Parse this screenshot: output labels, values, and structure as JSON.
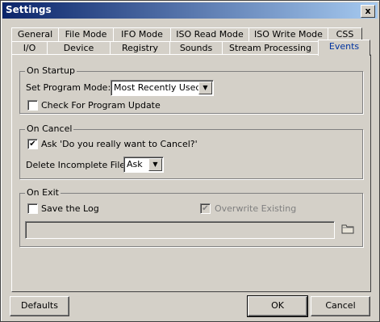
{
  "window": {
    "title": "Settings",
    "close_label": "x"
  },
  "tabs_row1": [
    "General",
    "File Mode",
    "IFO Mode",
    "ISO Read Mode",
    "ISO Write Mode",
    "CSS"
  ],
  "tabs_row2": [
    "I/O",
    "Device",
    "Registry",
    "Sounds",
    "Stream Processing",
    "Events"
  ],
  "active_tab": "Events",
  "startup": {
    "label": "On Startup",
    "program_mode_label": "Set Program Mode:",
    "program_mode_value": "Most Recently Used",
    "check_update_label": "Check For Program Update",
    "check_update_checked": false
  },
  "cancel": {
    "label": "On Cancel",
    "ask_label": "Ask 'Do you really want to Cancel?'",
    "ask_checked": true,
    "delete_label": "Delete Incomplete Files:",
    "delete_value": "Ask"
  },
  "exit": {
    "label": "On Exit",
    "save_log_label": "Save the Log",
    "save_log_checked": false,
    "overwrite_label": "Overwrite Existing",
    "overwrite_checked": true,
    "log_path": ""
  },
  "buttons": {
    "defaults": "Defaults",
    "ok": "OK",
    "cancel": "Cancel"
  }
}
